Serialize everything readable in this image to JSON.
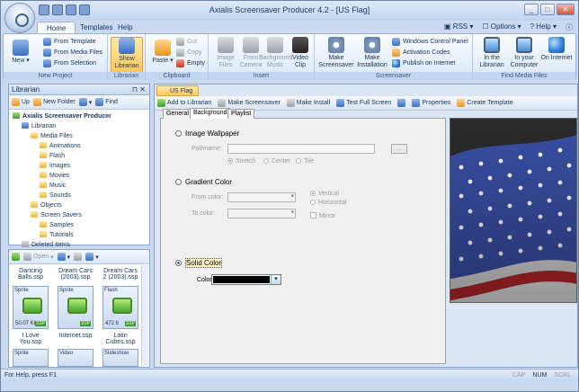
{
  "window": {
    "title": "Axialis Screensaver Producer 4.2 - [US Flag]"
  },
  "ribbon_tabs": [
    "Home",
    "Templates",
    "Help"
  ],
  "top_links": {
    "rss": "RSS",
    "options": "Options",
    "help": "Help"
  },
  "ribbon": {
    "new_project": {
      "label": "New Project",
      "new": "New",
      "from_template": "From Template",
      "from_media": "From Media Files",
      "from_selection": "From Selection"
    },
    "librarian": {
      "label": "Librarian",
      "show": "Show Librarian"
    },
    "clipboard": {
      "label": "Clipboard",
      "paste": "Paste",
      "cut": "Cut",
      "copy": "Copy",
      "empty": "Empty"
    },
    "insert": {
      "label": "Insert",
      "image": "Image Files",
      "camera": "From Camera",
      "music": "Background Music",
      "video": "Video Clip"
    },
    "screensaver": {
      "label": "Screensaver",
      "make": "Make Screensaver",
      "install": "Make Installation",
      "wcp": "Windows Control Panel",
      "activation": "Activation Codes",
      "publish": "Publish on Internet"
    },
    "find": {
      "label": "Find Media Files",
      "in_lib": "In the Librarian",
      "in_comp": "In your Computer",
      "on_internet": "On Internet"
    }
  },
  "librarian": {
    "title": "Librarian",
    "toolbar": {
      "up": "Up",
      "new_folder": "New Folder",
      "find": "Find"
    },
    "tree": {
      "root": "Axialis Screensaver Producer",
      "librarian": "Librarian",
      "media": "Media Files",
      "animations": "Animations",
      "flash": "Flash",
      "images": "Images",
      "movies": "Movies",
      "music": "Music",
      "sounds": "Sounds",
      "objects": "Objects",
      "savers": "Screen Savers",
      "samples": "Samples",
      "tutorials": "Tutorials",
      "deleted": "Deleted Items"
    },
    "grid_toolbar": {
      "open": "Open"
    },
    "files": [
      {
        "name": "Dancing Balls.ssp",
        "kind": "Sprite",
        "size": "50.07 Kb"
      },
      {
        "name": "Dream Cars (2003).ssp",
        "kind": "Sprite",
        "size": ""
      },
      {
        "name": "Dream Cars 2 (2003).ssp",
        "kind": "Flash",
        "size": "472 b"
      },
      {
        "name": "I Love You.ssp",
        "kind": "Sprite",
        "size": ""
      },
      {
        "name": "Internet.ssp",
        "kind": "Video",
        "size": ""
      },
      {
        "name": "Latin Cubes.ssp",
        "kind": "Slideshow",
        "size": ""
      }
    ],
    "ssp_badge": "SSP"
  },
  "document": {
    "tab": "US Flag",
    "toolbar": {
      "add": "Add to Librarian",
      "make": "Make Screensaver",
      "install": "Make Install",
      "test": "Test Full Screen",
      "props": "Properties",
      "template": "Create Template"
    },
    "prop_tabs": [
      "General",
      "Background",
      "Playlist"
    ],
    "image_wallpaper": "Image Wallpaper",
    "pathname": "Pathname:",
    "browse": "...",
    "stretch": "Stretch",
    "center": "Center",
    "tile": "Tile",
    "gradient": "Gradient Color",
    "from_color": "From color:",
    "to_color": "To color:",
    "vertical": "Vertical",
    "horizontal": "Horizontal",
    "mirror": "Mirror",
    "solid": "Solid Color",
    "color": "Color:",
    "color_value": "#000000"
  },
  "status": {
    "left": "For Help, press F1",
    "cap": "CAP",
    "num": "NUM",
    "scrl": "SCRL"
  }
}
